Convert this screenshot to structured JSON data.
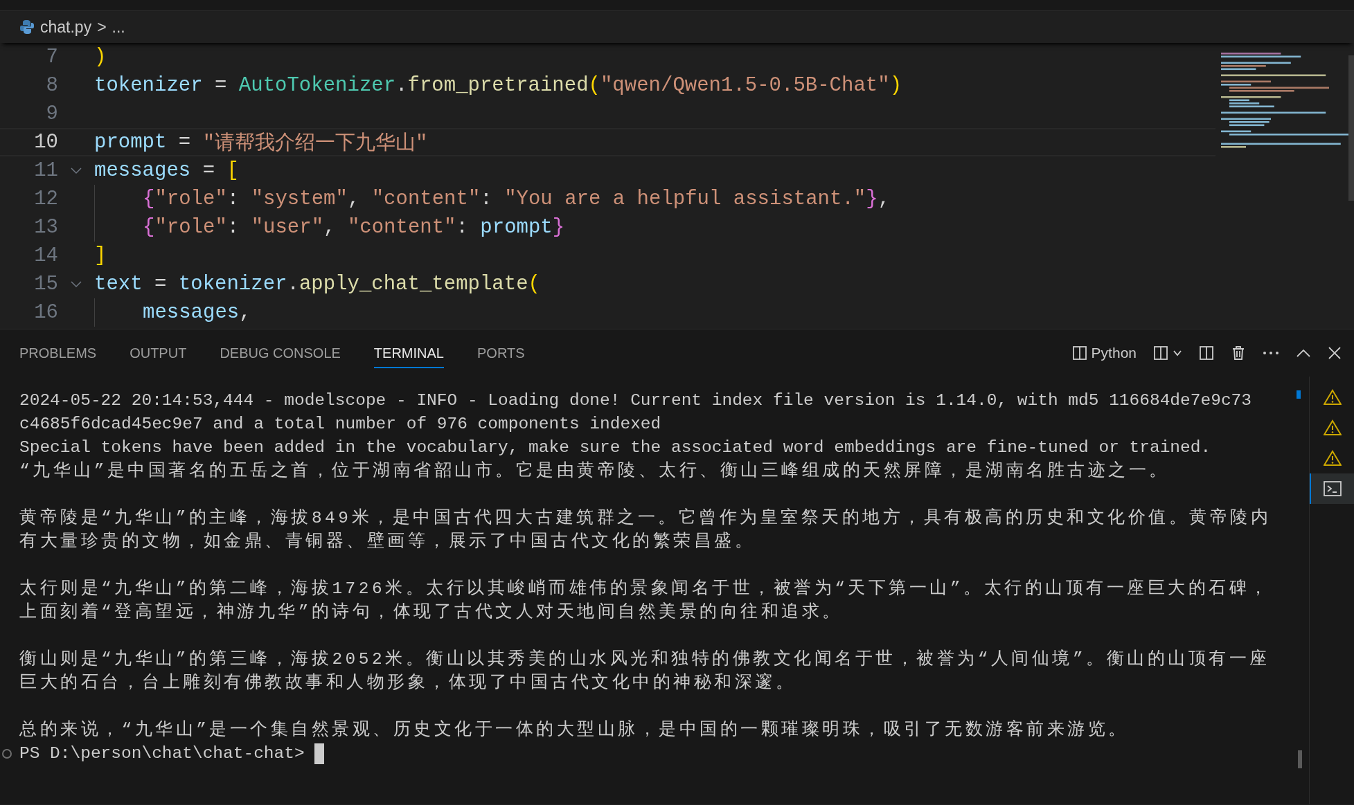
{
  "breadcrumb": {
    "file": "chat.py",
    "separator": ">",
    "rest": "..."
  },
  "editor": {
    "lines": [
      {
        "number": "7",
        "current": false,
        "foldable": false,
        "indented": false,
        "tokens": [
          {
            "text": ")",
            "kind": "bracket1"
          }
        ]
      },
      {
        "number": "8",
        "current": false,
        "foldable": false,
        "indented": false,
        "tokens": [
          {
            "text": "tokenizer",
            "kind": "variable"
          },
          {
            "text": " = ",
            "kind": "plain"
          },
          {
            "text": "AutoTokenizer",
            "kind": "class"
          },
          {
            "text": ".",
            "kind": "plain"
          },
          {
            "text": "from_pretrained",
            "kind": "function"
          },
          {
            "text": "(",
            "kind": "bracket1"
          },
          {
            "text": "\"qwen/Qwen1.5-0.5B-Chat\"",
            "kind": "string"
          },
          {
            "text": ")",
            "kind": "bracket1"
          }
        ]
      },
      {
        "number": "9",
        "current": false,
        "foldable": false,
        "indented": false
      },
      {
        "number": "10",
        "current": true,
        "foldable": false,
        "indented": false,
        "tokens": [
          {
            "text": "prompt",
            "kind": "variable"
          },
          {
            "text": " = ",
            "kind": "plain"
          },
          {
            "text": "\"请帮我介绍一下九华山\"",
            "kind": "string"
          }
        ]
      },
      {
        "number": "11",
        "current": false,
        "foldable": true,
        "indented": false,
        "tokens": [
          {
            "text": "messages",
            "kind": "variable"
          },
          {
            "text": " = ",
            "kind": "plain"
          },
          {
            "text": "[",
            "kind": "bracket1"
          }
        ]
      },
      {
        "number": "12",
        "current": false,
        "foldable": false,
        "indented": true,
        "tokens": [
          {
            "text": "{",
            "kind": "bracket2"
          },
          {
            "text": "\"role\"",
            "kind": "string"
          },
          {
            "text": ": ",
            "kind": "plain"
          },
          {
            "text": "\"system\"",
            "kind": "string"
          },
          {
            "text": ", ",
            "kind": "plain"
          },
          {
            "text": "\"content\"",
            "kind": "string"
          },
          {
            "text": ": ",
            "kind": "plain"
          },
          {
            "text": "\"You are a helpful assistant.\"",
            "kind": "string"
          },
          {
            "text": "}",
            "kind": "bracket2"
          },
          {
            "text": ",",
            "kind": "plain"
          }
        ]
      },
      {
        "number": "13",
        "current": false,
        "foldable": false,
        "indented": true,
        "tokens": [
          {
            "text": "{",
            "kind": "bracket2"
          },
          {
            "text": "\"role\"",
            "kind": "string"
          },
          {
            "text": ": ",
            "kind": "plain"
          },
          {
            "text": "\"user\"",
            "kind": "string"
          },
          {
            "text": ", ",
            "kind": "plain"
          },
          {
            "text": "\"content\"",
            "kind": "string"
          },
          {
            "text": ": ",
            "kind": "plain"
          },
          {
            "text": "prompt",
            "kind": "variable"
          },
          {
            "text": "}",
            "kind": "bracket2"
          }
        ]
      },
      {
        "number": "14",
        "current": false,
        "foldable": false,
        "indented": false,
        "tokens": [
          {
            "text": "]",
            "kind": "bracket1"
          }
        ]
      },
      {
        "number": "15",
        "current": false,
        "foldable": true,
        "indented": false,
        "tokens": [
          {
            "text": "text",
            "kind": "variable"
          },
          {
            "text": " = ",
            "kind": "plain"
          },
          {
            "text": "tokenizer",
            "kind": "variable"
          },
          {
            "text": ".",
            "kind": "plain"
          },
          {
            "text": "apply_chat_template",
            "kind": "function"
          },
          {
            "text": "(",
            "kind": "bracket1"
          }
        ]
      },
      {
        "number": "16",
        "current": false,
        "foldable": false,
        "indented": true,
        "tokens": [
          {
            "text": "messages",
            "kind": "variable"
          },
          {
            "text": ",",
            "kind": "plain"
          }
        ]
      }
    ]
  },
  "panel": {
    "tabs": [
      {
        "label": "PROBLEMS",
        "selected": false
      },
      {
        "label": "OUTPUT",
        "selected": false
      },
      {
        "label": "DEBUG CONSOLE",
        "selected": false
      },
      {
        "label": "TERMINAL",
        "selected": true
      },
      {
        "label": "PORTS",
        "selected": false
      }
    ],
    "actions": [
      {
        "kind": "profile",
        "label": "Python"
      },
      {
        "kind": "layout"
      },
      {
        "kind": "split"
      },
      {
        "kind": "trash"
      },
      {
        "kind": "more"
      },
      {
        "kind": "maximize"
      },
      {
        "kind": "close"
      }
    ]
  },
  "terminal": {
    "blocks": [
      {
        "lines": [
          "2024-05-22 20:14:53,444 - modelscope - INFO - Loading done! Current index file version is 1.14.0, with md5 116684de7e9c73",
          "c4685f6dcad45ec9e7 and a total number of 976 components indexed",
          "Special tokens have been added in the vocabulary, make sure the associated word embeddings are fine-tuned or trained.",
          "“九华山”是中国著名的五岳之首，位于湖南省韶山市。它是由黄帝陵、太行、衡山三峰组成的天然屏障，是湖南名胜古迹之一。"
        ]
      },
      {
        "lines": [
          "黄帝陵是“九华山”的主峰，海拔849米，是中国古代四大古建筑群之一。它曾作为皇室祭天的地方，具有极高的历史和文化价值。黄帝陵内",
          "有大量珍贵的文物，如金鼎、青铜器、壁画等，展示了中国古代文化的繁荣昌盛。"
        ]
      },
      {
        "lines": [
          "太行则是“九华山”的第二峰，海拔1726米。太行以其峻峭而雄伟的景象闻名于世，被誉为“天下第一山”。太行的山顶有一座巨大的石碑，",
          "上面刻着“登高望远，神游九华”的诗句，体现了古代文人对天地间自然美景的向往和追求。"
        ]
      },
      {
        "lines": [
          "衡山则是“九华山”的第三峰，海拔2052米。衡山以其秀美的山水风光和独特的佛教文化闻名于世，被誉为“人间仙境”。衡山的山顶有一座",
          "巨大的石台，台上雕刻有佛教故事和人物形象，体现了中国古代文化中的神秘和深邃。"
        ]
      },
      {
        "lines": [
          "总的来说，“九华山”是一个集自然景观、历史文化于一体的大型山脉，是中国的一颗璀璨明珠，吸引了无数游客前来游览。"
        ]
      }
    ],
    "prompt": "PS D:\\person\\chat\\chat-chat>",
    "instances": [
      {
        "kind": "warning",
        "selected": false
      },
      {
        "kind": "warning",
        "selected": false
      },
      {
        "kind": "warning",
        "selected": false
      },
      {
        "kind": "terminal",
        "selected": true
      }
    ]
  }
}
